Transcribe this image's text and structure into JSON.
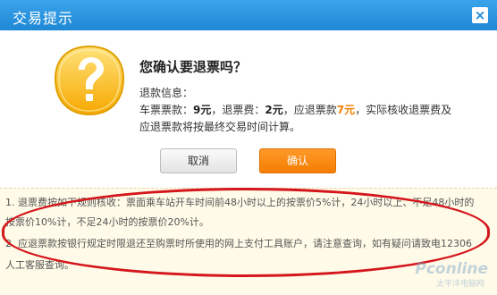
{
  "dialog": {
    "title": "交易提示",
    "close_symbol": "×"
  },
  "confirm": {
    "question": "您确认要退票吗？",
    "info_label": "退款信息：",
    "ticket_fee_label": "车票票款：",
    "ticket_fee": "9元",
    "refund_fee_label": "，退票费：",
    "refund_fee": "2元",
    "refund_amount_label": "，应退票款",
    "refund_amount": "7元",
    "tail": "，实际核收退票费及",
    "calc_note": "应退票款将按最终交易时间计算。"
  },
  "buttons": {
    "cancel": "取消",
    "confirm": "确认"
  },
  "notice": {
    "line1": "1. 退票费按如下规则核收：票面乘车站开车时间前48小时以上的按票价5%计，24小时以上、不足48小时的",
    "line2": "按票价10%计，不足24小时的按票价20%计。",
    "line3": "2. 应退票款按银行规定时限退还至购票时所使用的网上支付工具账户，请注意查询，如有疑问请致电12306",
    "line4": "人工客服查询。"
  },
  "watermark": {
    "brand": "Pconline",
    "sub": "太平洋电脑网"
  },
  "colors": {
    "titlebar": "#2a94de",
    "highlight": "#f07f00",
    "confirm_button": "#f58400",
    "annotation_oval": "#d4161c"
  },
  "icons": {
    "close": "close-icon",
    "warning": "question-mark-icon"
  }
}
